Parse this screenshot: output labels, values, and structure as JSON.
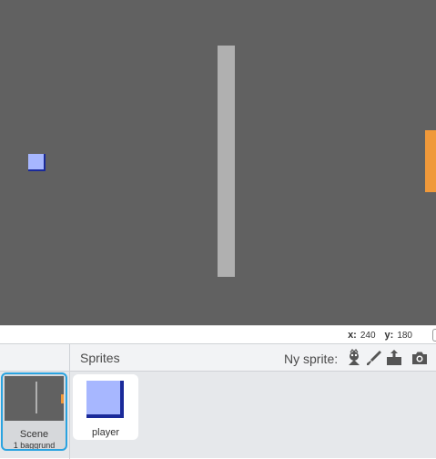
{
  "stage": {
    "colors": {
      "background": "#616161",
      "wall": "#b0b0b0",
      "player": "#a7b7ff",
      "player_shadow": "#1a2a9a",
      "goal": "#f0993a"
    }
  },
  "status": {
    "x_label": "x:",
    "x_value": "240",
    "y_label": "y:",
    "y_value": "180"
  },
  "sprites_pane": {
    "title": "Sprites",
    "new_sprite_label": "Ny sprite:",
    "tools": [
      {
        "icon": "sprite-library-icon"
      },
      {
        "icon": "paint-brush-icon"
      },
      {
        "icon": "upload-icon"
      },
      {
        "icon": "camera-icon"
      }
    ],
    "scene": {
      "name": "Scene",
      "subtitle": "1 baggrund"
    },
    "sprites": [
      {
        "name": "player"
      }
    ],
    "accent": "#2aa3e0"
  }
}
